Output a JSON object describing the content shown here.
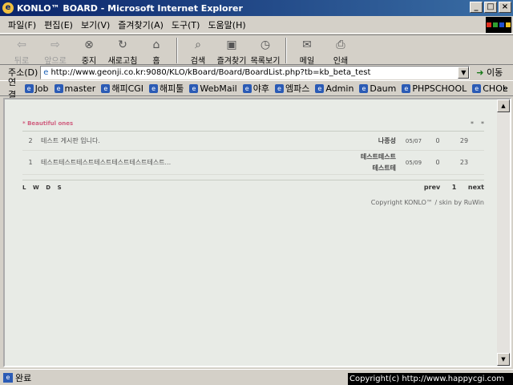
{
  "window": {
    "title": "KONLO™ BOARD - Microsoft Internet Explorer",
    "minimize": "_",
    "maximize": "□",
    "close": "×"
  },
  "menu": [
    "파일(F)",
    "편집(E)",
    "보기(V)",
    "즐겨찾기(A)",
    "도구(T)",
    "도움말(H)"
  ],
  "toolbar": {
    "back": "뒤로",
    "forward": "앞으로",
    "stop": "중지",
    "refresh": "새로고침",
    "home": "홈",
    "search": "검색",
    "favorites": "즐겨찾기",
    "history": "목록보기",
    "mail": "메일",
    "print": "인쇄"
  },
  "address": {
    "label": "주소(D)",
    "url": "http://www.geonji.co.kr:9080/KLO/kBoard/Board/BoardList.php?tb=kb_beta_test",
    "go": "이동"
  },
  "links": {
    "label": "연결",
    "items": [
      "Job",
      "master",
      "해피CGI",
      "해피툴",
      "WebMail",
      "야후",
      "엠파스",
      "Admin",
      "Daum",
      "PHPSCHOOL",
      "CHOL"
    ],
    "more": "»"
  },
  "board": {
    "title": "* Beautiful ones",
    "head_marks": [
      "*",
      "*"
    ],
    "rows": [
      {
        "num": "2",
        "subject": "테스트 게시판 입니다.",
        "writer": "나종성",
        "date": "05/07",
        "comments": "0",
        "hits": "29"
      },
      {
        "num": "1",
        "subject": "테스트테스트테스트테스트테스트테스트테스트...",
        "writer_line1": "테스트테스트",
        "writer_line2": "테스트테",
        "date": "05/09",
        "comments": "0",
        "hits": "23"
      }
    ],
    "codes": [
      "L",
      "W",
      "D",
      "S"
    ],
    "pager": {
      "prev": "prev",
      "page": "1",
      "next": "next"
    },
    "copyright": "Copyright KONLO™ / skin by RuWin"
  },
  "status": {
    "text": "완료"
  },
  "overlay": "Copyright(c) http://www.happycgi.com"
}
